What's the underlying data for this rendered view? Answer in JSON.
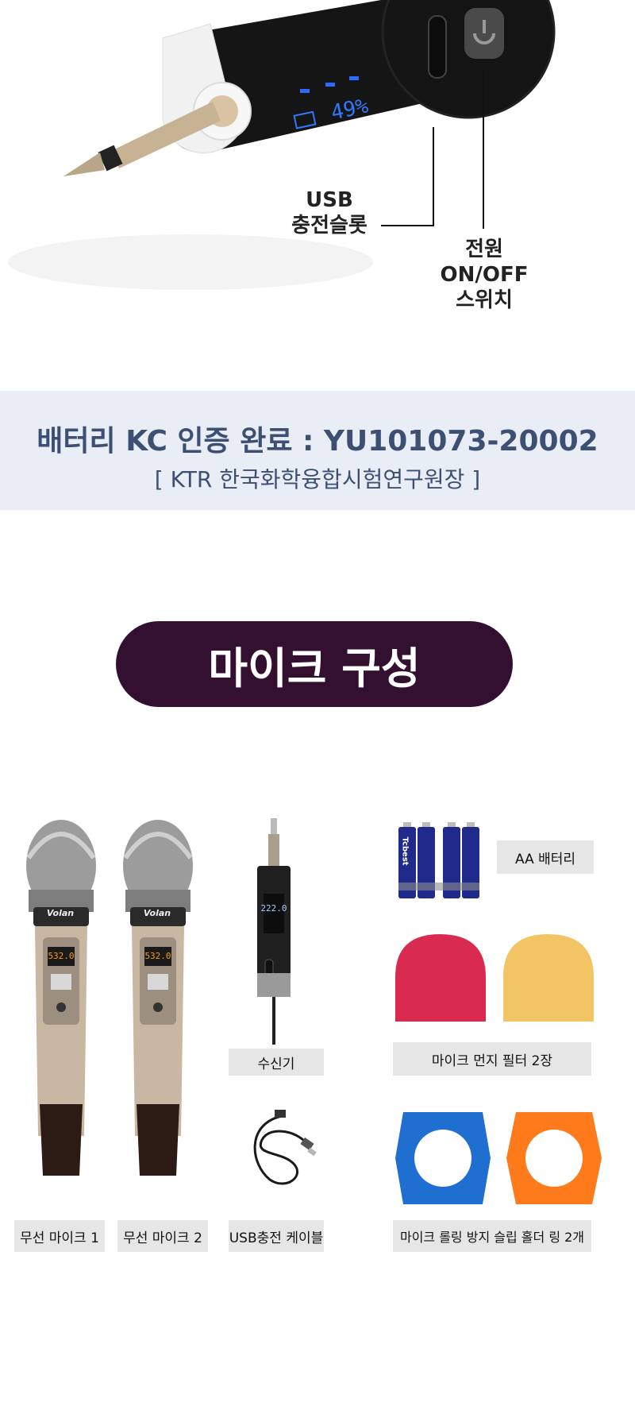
{
  "top_section": {
    "display_readout": "49%",
    "callout_usb": [
      "USB",
      "충전슬롯"
    ],
    "callout_power": [
      "전원",
      "ON/OFF",
      "스위치"
    ]
  },
  "certification": {
    "title": "배터리 KC 인증 완료 : YU101073-20002",
    "subtitle": "[ KTR 한국화학융합시험연구원장 ]",
    "title_color": "#3d4f73",
    "band_color": "#e9eef6"
  },
  "components": {
    "heading": "마이크 구성",
    "heading_bg": "#341030",
    "mic_brand": "Volan",
    "mic_display": "532.0",
    "receiver_display": "222.0",
    "labels": {
      "mic1": "무선 마이크 1",
      "mic2": "무선 마이크 2",
      "receiver": "수신기",
      "usb_cable": "USB충전 케이블",
      "battery": "AA 배터리",
      "filter": "마이크 먼지 필터  2장",
      "ring": "마이크 롤링 방지 슬립 홀더 링 2개"
    },
    "battery_brand": "Tcbest"
  }
}
